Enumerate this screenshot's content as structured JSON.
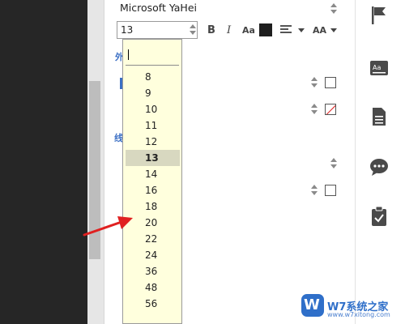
{
  "font": {
    "family_value": "Microsoft YaHei",
    "size_value": "13"
  },
  "toolbar": {
    "bold_label": "B",
    "italic_label": "I",
    "aa_label": "Aa",
    "case_label": "AA",
    "text_color": "#1e1e1e"
  },
  "sections": {
    "first_label": "外",
    "second_label": "线"
  },
  "size_dropdown": {
    "options": [
      "8",
      "9",
      "10",
      "11",
      "12",
      "13",
      "14",
      "16",
      "18",
      "20",
      "22",
      "24",
      "36",
      "48",
      "56"
    ],
    "selected": "13"
  },
  "right_sidebar": {
    "icons": [
      "flag-icon",
      "text-format-icon",
      "document-icon",
      "comment-icon",
      "clipboard-check-icon"
    ]
  },
  "annotation": {
    "arrow_color": "#e02020"
  },
  "watermark": {
    "logo_letter": "W",
    "text": "W7系统之家",
    "url": "www.w7xitong.com"
  }
}
